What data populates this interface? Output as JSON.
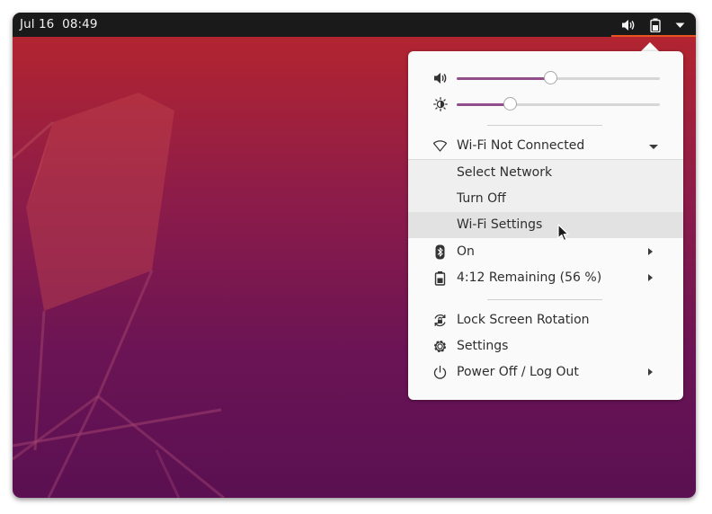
{
  "topbar": {
    "clock": "Jul 16  08:49",
    "tray_icons": [
      "speaker-icon",
      "battery-icon",
      "chevron-down-icon"
    ]
  },
  "colors": {
    "accent": "#e95420",
    "slider_fill": "#924d8b",
    "wallpaper_top": "#b8262c",
    "wallpaper_bottom": "#5a1052"
  },
  "menu": {
    "volume": {
      "icon": "speaker-icon",
      "level_fraction": 0.46
    },
    "brightness": {
      "icon": "brightness-icon",
      "level_fraction": 0.26
    },
    "wifi": {
      "icon": "wifi-icon",
      "label": "Wi-Fi Not Connected",
      "submenu": [
        {
          "label": "Select Network"
        },
        {
          "label": "Turn Off"
        },
        {
          "label": "Wi-Fi Settings"
        }
      ]
    },
    "bluetooth": {
      "icon": "bluetooth-icon",
      "label": "On"
    },
    "battery": {
      "icon": "battery-icon",
      "label": "4:12 Remaining (56 %)"
    },
    "lock_rotation": {
      "icon": "rotation-lock-icon",
      "label": "Lock Screen Rotation"
    },
    "settings": {
      "icon": "gear-icon",
      "label": "Settings"
    },
    "power": {
      "icon": "power-icon",
      "label": "Power Off / Log Out"
    }
  }
}
